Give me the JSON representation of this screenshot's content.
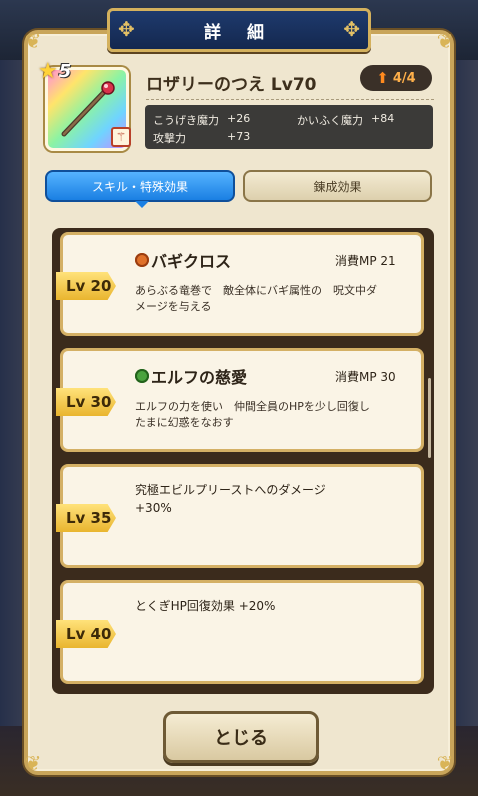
{
  "dialog": {
    "title": "詳 細",
    "close_label": "とじる"
  },
  "weapon": {
    "stars": "★",
    "rank": "5",
    "type_icon": "staff-type-icon",
    "name": "ロザリーのつえ Lv70",
    "upgrade": "4/4"
  },
  "stats": [
    {
      "label": "こうげき魔力",
      "value": "+26"
    },
    {
      "label": "かいふく魔力",
      "value": "+84"
    },
    {
      "label": "攻撃力",
      "value": "+73"
    }
  ],
  "tabs": {
    "active": "スキル・特殊効果",
    "inactive": "錬成効果"
  },
  "skills": [
    {
      "lv": "Lv 20",
      "icon": "fire-skill-icon",
      "icon_color": "#e0712a",
      "name": "バギクロス",
      "mp": "消費MP 21",
      "desc1": "あらぶる竜巻で　敵全体にバギ属性の　呪文中ダ",
      "desc2": "メージを与える"
    },
    {
      "lv": "Lv 30",
      "icon": "heal-skill-icon",
      "icon_color": "#4aa33e",
      "name": "エルフの慈愛",
      "mp": "消費MP 30",
      "desc1": "エルフの力を使い　仲間全員のHPを少し回復し",
      "desc2": "たまに幻惑をなおす"
    },
    {
      "lv": "Lv 35",
      "line1": "究極エビルプリーストへのダメージ",
      "line2": "+30%"
    },
    {
      "lv": "Lv 40",
      "line1": "とくぎHP回復効果 +20%"
    }
  ]
}
